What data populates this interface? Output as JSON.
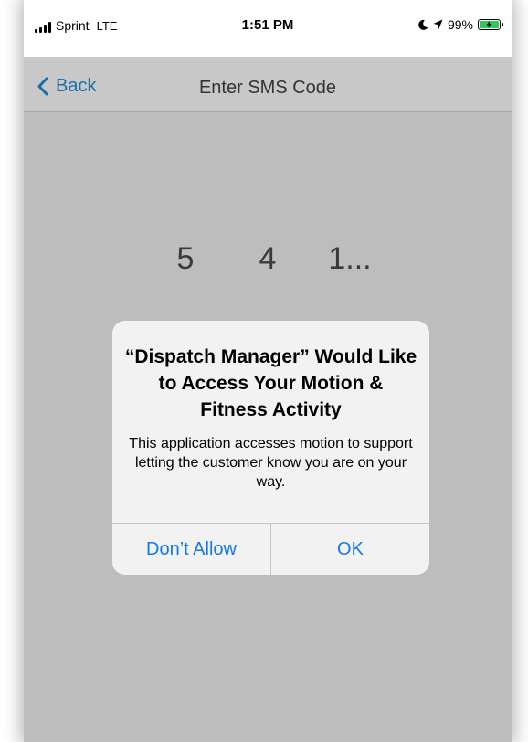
{
  "status_bar": {
    "carrier": "Sprint",
    "network": "LTE",
    "time": "1:51 PM",
    "battery": "99%",
    "battery_color": "#34c759"
  },
  "nav": {
    "back_label": "Back",
    "title": "Enter SMS Code"
  },
  "code": {
    "digits": [
      "5",
      "4",
      "1..."
    ]
  },
  "alert": {
    "title": "“Dispatch Manager” Would Like to Access Your Motion & Fitness Activity",
    "message": "This application accesses motion to support letting the customer know you are on your way.",
    "deny_label": "Don’t Allow",
    "ok_label": "OK"
  },
  "colors": {
    "accent": "#1479e6",
    "nav_accent": "#1d6ea8",
    "dim_background": "#bdbdbd"
  }
}
